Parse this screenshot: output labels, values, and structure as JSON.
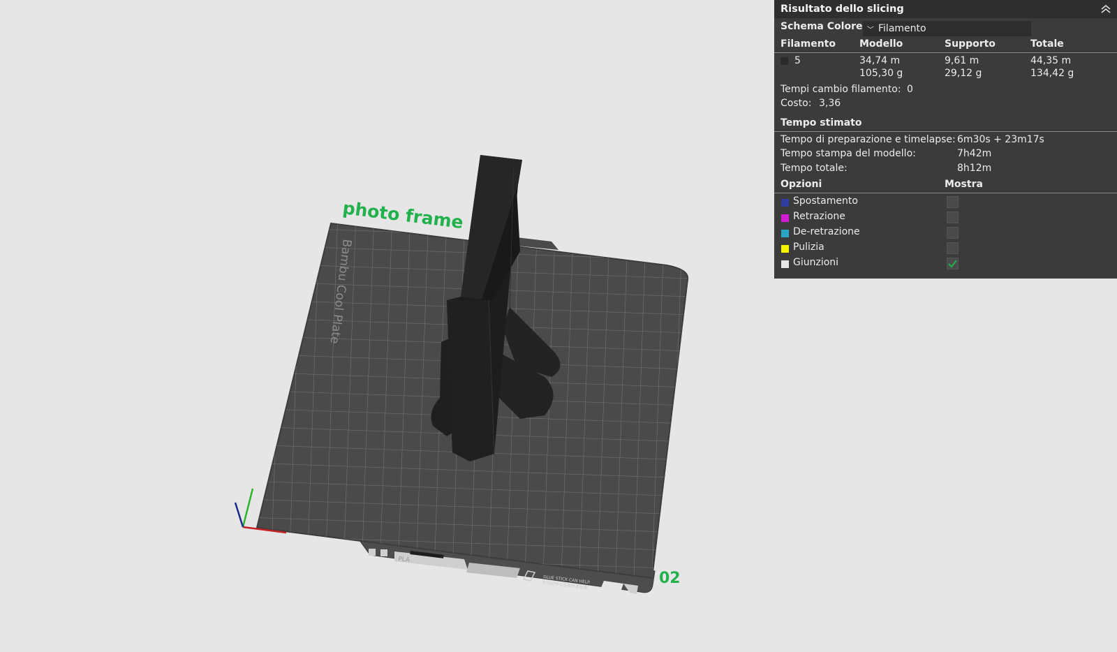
{
  "viewport": {
    "plate_name": "photo frame",
    "plate_number": "02",
    "plate_brand_label": "Bambu Cool Plate",
    "plate_tag": "PLA",
    "plate_glue_text": "GLUE STICK CAN HELP.",
    "plate_cn_text": "专用胶棒可改善附着效果"
  },
  "panel": {
    "title": "Risultato dello slicing",
    "color_scheme_label": "Schema Colore",
    "color_scheme_value": "Filamento",
    "columns": {
      "filament": "Filamento",
      "model": "Modello",
      "support": "Supporto",
      "total": "Totale"
    },
    "filament_row": {
      "id": "5",
      "swatch_color": "#2a2a2a",
      "model_length": "34,74 m",
      "model_weight": "105,30 g",
      "support_length": "9,61 m",
      "support_weight": "29,12 g",
      "total_length": "44,35 m",
      "total_weight": "134,42 g"
    },
    "change_times_label": "Tempi cambio filamento:",
    "change_times_value": "0",
    "cost_label": "Costo:",
    "cost_value": "3,36",
    "time_header": "Tempo stimato",
    "prep_label": "Tempo di preparazione e timelapse:",
    "prep_value": "6m30s + 23m17s",
    "model_time_label": "Tempo stampa del modello:",
    "model_time_value": "7h42m",
    "total_time_label": "Tempo totale:",
    "total_time_value": "8h12m",
    "options_header": "Opzioni",
    "show_header": "Mostra",
    "options": [
      {
        "label": "Spostamento",
        "color": "#2e3d9e",
        "checked": false
      },
      {
        "label": "Retrazione",
        "color": "#d21bd2",
        "checked": false
      },
      {
        "label": "De-retrazione",
        "color": "#2aa6c4",
        "checked": false
      },
      {
        "label": "Pulizia",
        "color": "#f5f500",
        "checked": false
      },
      {
        "label": "Giunzioni",
        "color": "#e8e8e8",
        "checked": true
      }
    ]
  }
}
